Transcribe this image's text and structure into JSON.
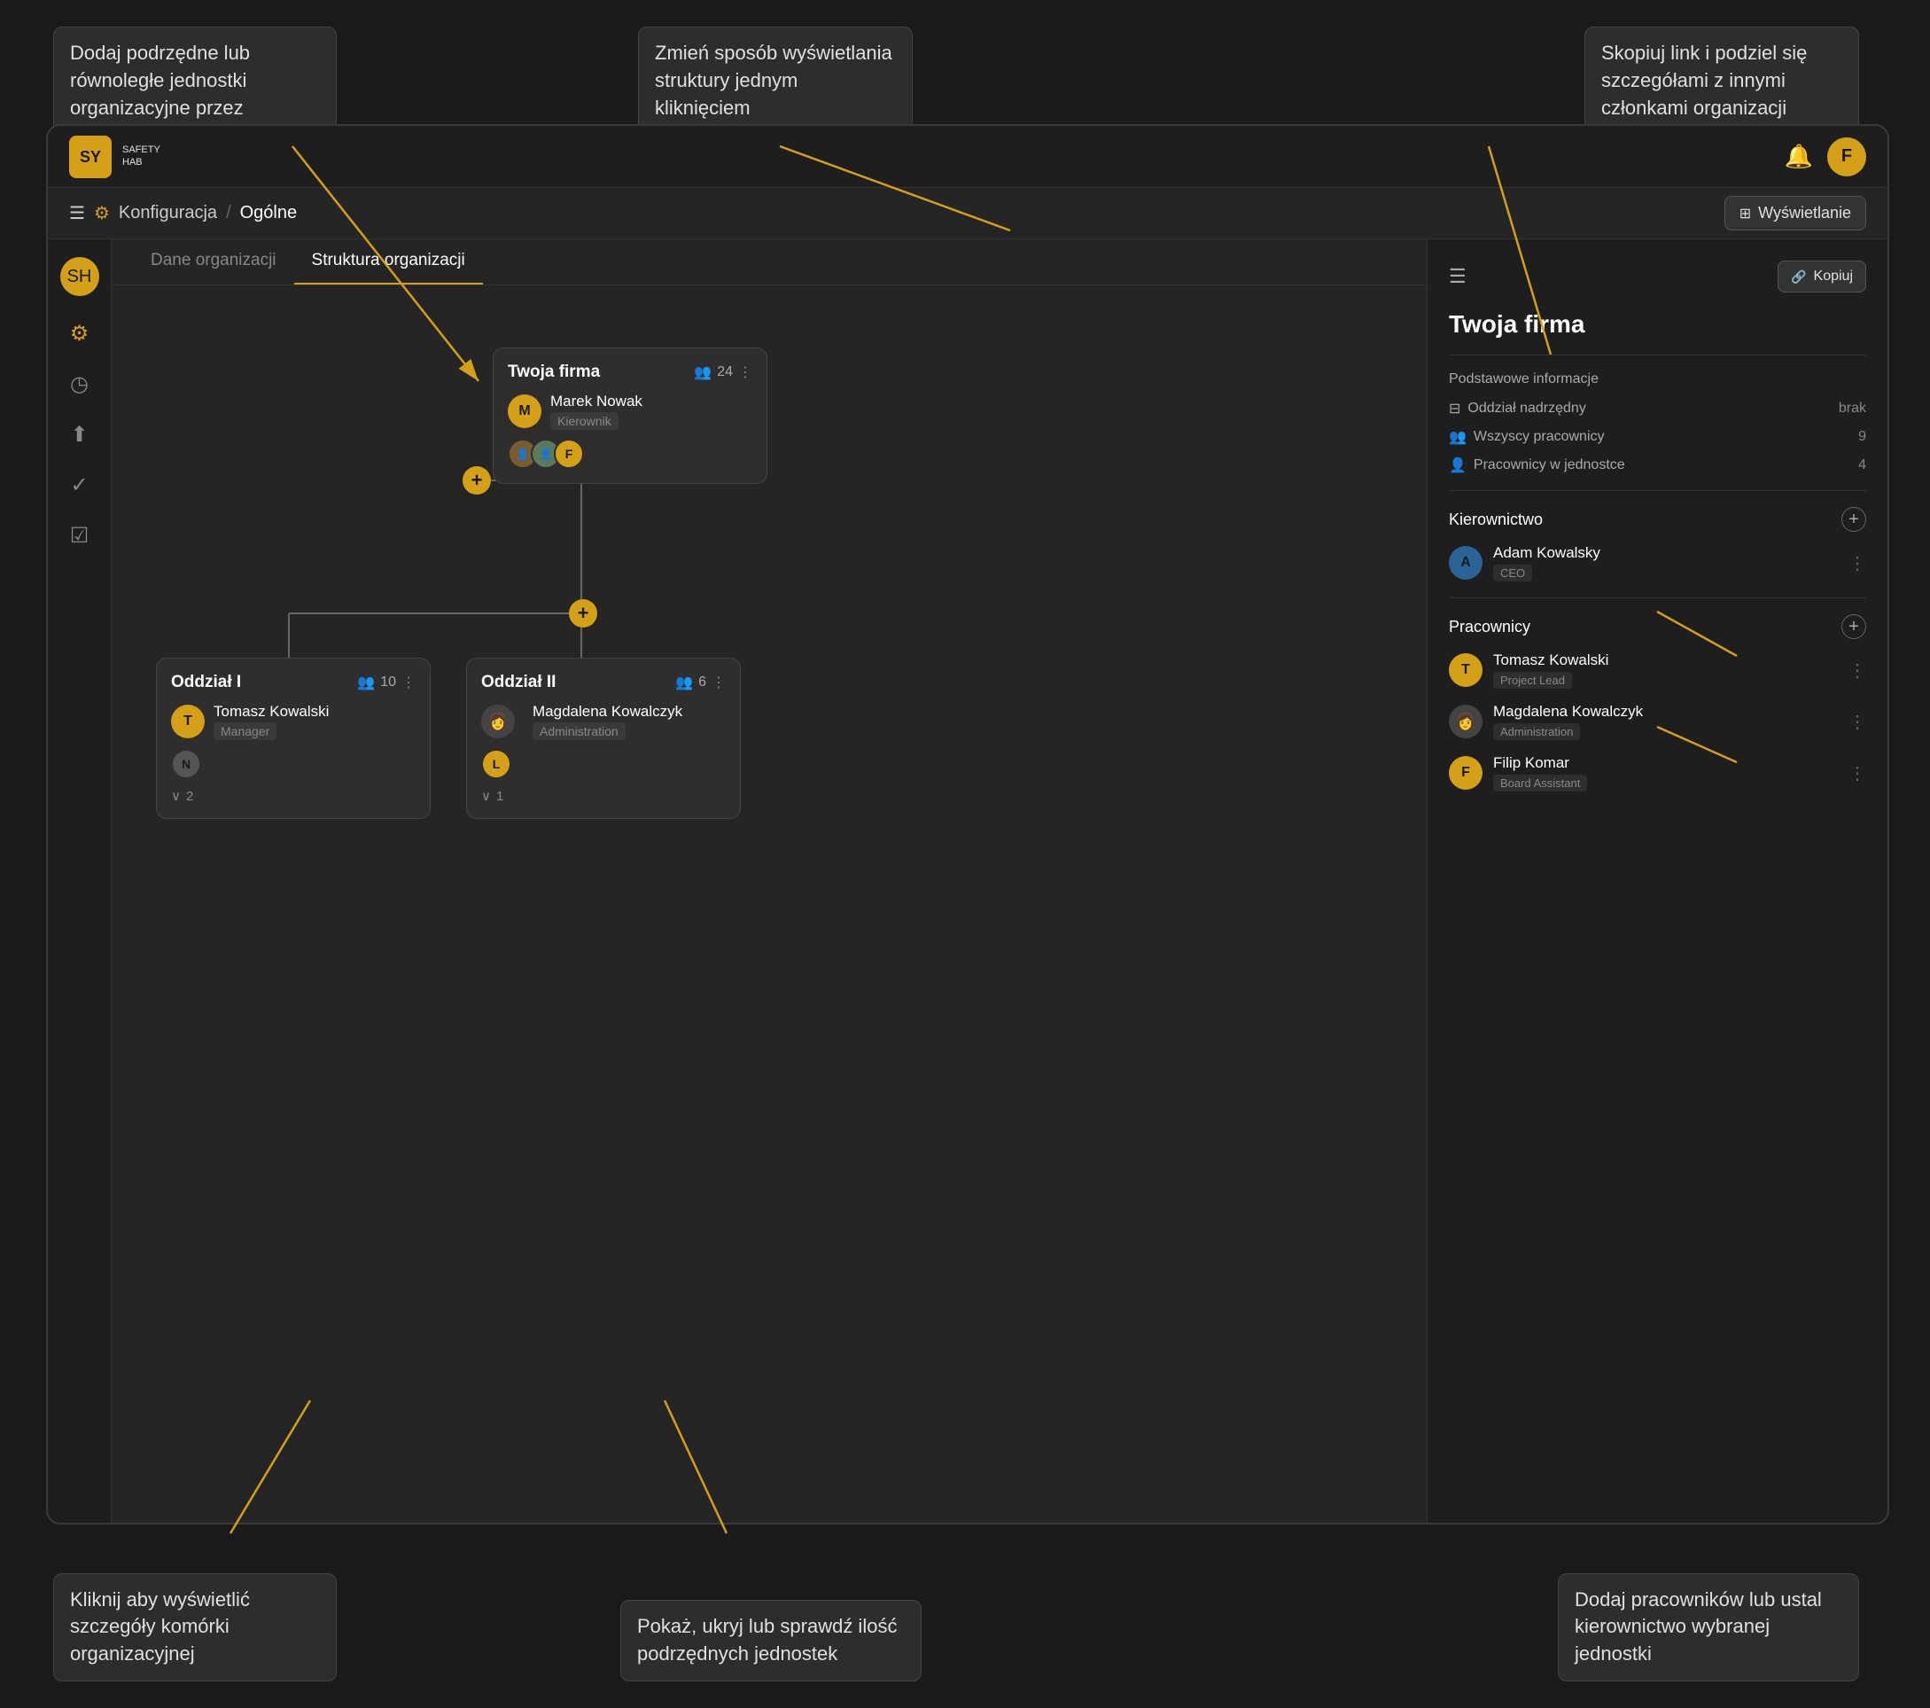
{
  "tooltips": {
    "tl": "Dodaj podrzędne lub równoległe jednostki organizacyjne przez kliknięcie w plus",
    "tc": "Zmień sposób wyświetlania struktury jednym kliknięciem",
    "tr": "Skopiuj link i podziel się szczegółami z innymi członkami organizacji",
    "bl": "Kliknij aby wyświetlić szczegóły komórki organizacyjnej",
    "bc": "Pokaż, ukryj lub sprawdź ilość podrzędnych jednostek",
    "br": "Dodaj pracowników lub ustal kierownictwo wybranej jednostki"
  },
  "topbar": {
    "logo_line1": "SY",
    "logo_line2": "SAFETY",
    "logo_line3": "HAB",
    "bell_icon": "🔔",
    "user_initial": "F"
  },
  "breadcrumb": {
    "icon": "☰",
    "settings_icon": "⚙",
    "path1": "Konfiguracja",
    "separator": "/",
    "path2": "Ogólne",
    "display_btn": "Wyświetlanie"
  },
  "tabs": [
    {
      "id": "dane",
      "label": "Dane organizacji",
      "active": false
    },
    {
      "id": "struktura",
      "label": "Struktura organizacji",
      "active": true
    }
  ],
  "sidebar": {
    "icons": [
      "⚙",
      "◷",
      "⬆",
      "✓",
      "☑"
    ]
  },
  "org": {
    "main_node": {
      "title": "Twoja firma",
      "count": 24,
      "manager_initial": "M",
      "manager_initial_color": "#d4a017",
      "manager_name": "Marek Nowak",
      "manager_role": "Kierownik",
      "avatars": [
        "photo1",
        "photo2",
        "F"
      ]
    },
    "branch1": {
      "title": "Oddział I",
      "count": 10,
      "manager_initial": "T",
      "manager_initial_color": "#d4a017",
      "manager_name": "Tomasz Kowalski",
      "manager_role": "Manager",
      "extra_initial": "N",
      "extra_color": "#555",
      "collapse_count": 2
    },
    "branch2": {
      "title": "Oddział II",
      "count": 6,
      "manager_photo": true,
      "manager_name": "Magdalena Kowalczyk",
      "manager_role": "Administration",
      "extra_initial": "L",
      "extra_color": "#d4a017",
      "collapse_count": 1
    }
  },
  "right_panel": {
    "title": "Twoja firma",
    "copy_btn": "Kopiuj",
    "basic_info_title": "Podstawowe informacje",
    "parent_branch_label": "Oddział nadrzędny",
    "parent_branch_value": "brak",
    "all_employees_label": "Wszyscy pracownicy",
    "all_employees_value": "9",
    "unit_employees_label": "Pracownicy w jednostce",
    "unit_employees_value": "4",
    "management_title": "Kierownictwo",
    "management": [
      {
        "initial": "A",
        "color": "#2a6496",
        "name": "Adam Kowalsky",
        "role": "CEO"
      }
    ],
    "employees_title": "Pracownicy",
    "employees": [
      {
        "initial": "T",
        "color": "#d4a017",
        "name": "Tomasz Kowalski",
        "role": "Project Lead"
      },
      {
        "type": "photo",
        "name": "Magdalena Kowalczyk",
        "role": "Administration"
      },
      {
        "initial": "F",
        "color": "#d4a017",
        "name": "Filip Komar",
        "role": "Board Assistant"
      }
    ]
  }
}
